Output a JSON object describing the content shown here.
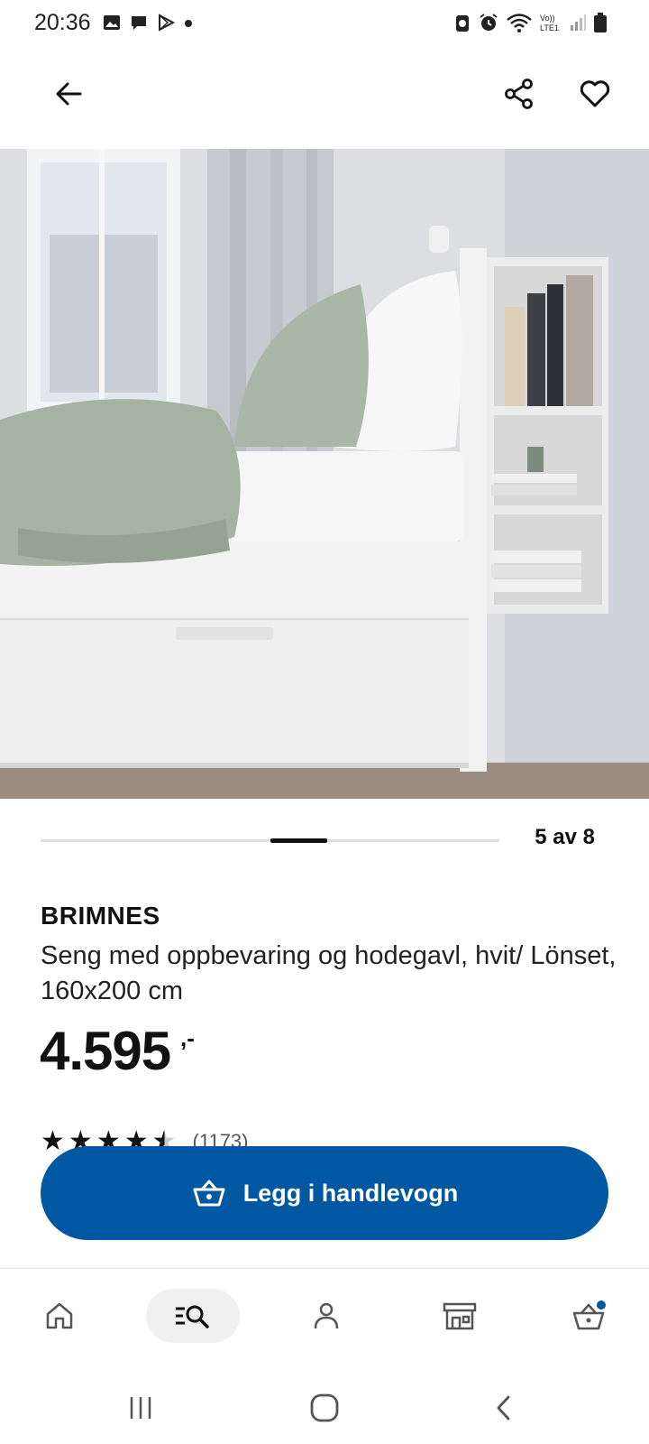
{
  "status_bar": {
    "time": "20:36",
    "left_icons": [
      "gallery-icon",
      "message-icon",
      "play-store-icon",
      "dot-icon"
    ],
    "right_icons": [
      "data-saver-icon",
      "alarm-icon",
      "wifi-icon",
      "volte-icon",
      "signal-icon",
      "battery-icon"
    ],
    "volte_top": "Vo))",
    "volte_bottom": "LTE1"
  },
  "top_bar": {
    "back_icon": "arrow-left-icon",
    "share_icon": "share-icon",
    "favorite_icon": "heart-icon"
  },
  "hero_image": {
    "description_icon": "product-photo"
  },
  "carousel": {
    "counter": "5 av 8",
    "position": 5,
    "total": 8
  },
  "product": {
    "name": "BRIMNES",
    "description": "Seng med oppbevaring og hodegavl, hvit/ Lönset, 160x200 cm",
    "price": "4.595",
    "price_suffix": ",-",
    "rating": 4.5,
    "review_count": "(1173)"
  },
  "cart_button": {
    "label": "Legg i handlevogn",
    "icon": "basket-icon",
    "color": "#0058a3"
  },
  "bottom_nav": {
    "items": [
      "home-icon",
      "search-icon",
      "profile-icon",
      "store-icon",
      "cart-icon"
    ],
    "active": "search-icon",
    "badge_color": "#0058a3"
  },
  "system_nav": [
    "recents-icon",
    "home-circle-icon",
    "back-chevron-icon"
  ]
}
